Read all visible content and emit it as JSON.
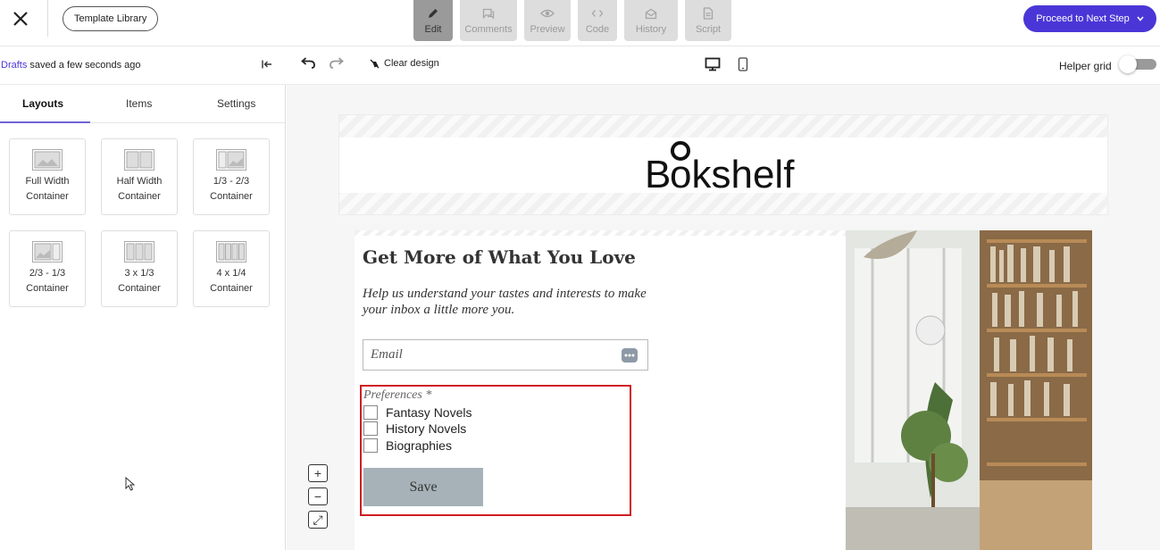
{
  "topbar": {
    "template_library_label": "Template Library",
    "mode_tabs": [
      {
        "label": "Edit",
        "icon": "pencil-icon",
        "active": true
      },
      {
        "label": "Comments",
        "icon": "comment-icon",
        "active": false
      },
      {
        "label": "Preview",
        "icon": "eye-icon",
        "active": false
      },
      {
        "label": "Code",
        "icon": "code-icon",
        "active": false
      },
      {
        "label": "History",
        "icon": "history-icon",
        "active": false
      },
      {
        "label": "Script",
        "icon": "script-icon",
        "active": false
      }
    ],
    "proceed_label": "Proceed to Next Step"
  },
  "subbar": {
    "drafts_link": "Drafts",
    "saved_text": " saved a few seconds ago",
    "clear_design_label": "Clear design",
    "helper_grid_label": "Helper grid",
    "helper_grid_on": false
  },
  "sidebar": {
    "tabs": [
      "Layouts",
      "Items",
      "Settings"
    ],
    "active_tab": "Layouts",
    "layouts": [
      {
        "line1": "Full Width",
        "line2": "Container"
      },
      {
        "line1": "Half Width",
        "line2": "Container"
      },
      {
        "line1": "1/3 - 2/3",
        "line2": "Container"
      },
      {
        "line1": "2/3 - 1/3",
        "line2": "Container"
      },
      {
        "line1": "3 x 1/3",
        "line2": "Container"
      },
      {
        "line1": "4 x 1/4",
        "line2": "Container"
      }
    ]
  },
  "canvas": {
    "logo_text": "Bookshelf",
    "form_title": "Get More of What You Love",
    "form_subtitle": "Help us understand your tastes and interests to make your inbox a little more you.",
    "email_placeholder": "Email",
    "preferences_label": "Preferences *",
    "options": [
      "Fantasy Novels",
      "History Novels",
      "Biographies"
    ],
    "save_label": "Save",
    "zoom_controls": [
      "+",
      "−",
      "⤢"
    ]
  },
  "colors": {
    "accent": "#4a36d6",
    "selection": "#d01c22",
    "save_button": "#a6b2b8"
  }
}
